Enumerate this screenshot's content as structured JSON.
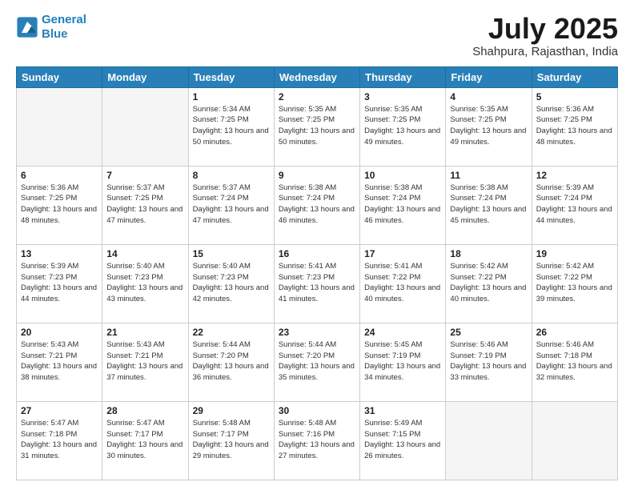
{
  "header": {
    "logo_line1": "General",
    "logo_line2": "Blue",
    "title": "July 2025",
    "subtitle": "Shahpura, Rajasthan, India"
  },
  "calendar": {
    "days_of_week": [
      "Sunday",
      "Monday",
      "Tuesday",
      "Wednesday",
      "Thursday",
      "Friday",
      "Saturday"
    ],
    "weeks": [
      [
        {
          "day": "",
          "info": ""
        },
        {
          "day": "",
          "info": ""
        },
        {
          "day": "1",
          "info": "Sunrise: 5:34 AM\nSunset: 7:25 PM\nDaylight: 13 hours and 50 minutes."
        },
        {
          "day": "2",
          "info": "Sunrise: 5:35 AM\nSunset: 7:25 PM\nDaylight: 13 hours and 50 minutes."
        },
        {
          "day": "3",
          "info": "Sunrise: 5:35 AM\nSunset: 7:25 PM\nDaylight: 13 hours and 49 minutes."
        },
        {
          "day": "4",
          "info": "Sunrise: 5:35 AM\nSunset: 7:25 PM\nDaylight: 13 hours and 49 minutes."
        },
        {
          "day": "5",
          "info": "Sunrise: 5:36 AM\nSunset: 7:25 PM\nDaylight: 13 hours and 48 minutes."
        }
      ],
      [
        {
          "day": "6",
          "info": "Sunrise: 5:36 AM\nSunset: 7:25 PM\nDaylight: 13 hours and 48 minutes."
        },
        {
          "day": "7",
          "info": "Sunrise: 5:37 AM\nSunset: 7:25 PM\nDaylight: 13 hours and 47 minutes."
        },
        {
          "day": "8",
          "info": "Sunrise: 5:37 AM\nSunset: 7:24 PM\nDaylight: 13 hours and 47 minutes."
        },
        {
          "day": "9",
          "info": "Sunrise: 5:38 AM\nSunset: 7:24 PM\nDaylight: 13 hours and 46 minutes."
        },
        {
          "day": "10",
          "info": "Sunrise: 5:38 AM\nSunset: 7:24 PM\nDaylight: 13 hours and 46 minutes."
        },
        {
          "day": "11",
          "info": "Sunrise: 5:38 AM\nSunset: 7:24 PM\nDaylight: 13 hours and 45 minutes."
        },
        {
          "day": "12",
          "info": "Sunrise: 5:39 AM\nSunset: 7:24 PM\nDaylight: 13 hours and 44 minutes."
        }
      ],
      [
        {
          "day": "13",
          "info": "Sunrise: 5:39 AM\nSunset: 7:23 PM\nDaylight: 13 hours and 44 minutes."
        },
        {
          "day": "14",
          "info": "Sunrise: 5:40 AM\nSunset: 7:23 PM\nDaylight: 13 hours and 43 minutes."
        },
        {
          "day": "15",
          "info": "Sunrise: 5:40 AM\nSunset: 7:23 PM\nDaylight: 13 hours and 42 minutes."
        },
        {
          "day": "16",
          "info": "Sunrise: 5:41 AM\nSunset: 7:23 PM\nDaylight: 13 hours and 41 minutes."
        },
        {
          "day": "17",
          "info": "Sunrise: 5:41 AM\nSunset: 7:22 PM\nDaylight: 13 hours and 40 minutes."
        },
        {
          "day": "18",
          "info": "Sunrise: 5:42 AM\nSunset: 7:22 PM\nDaylight: 13 hours and 40 minutes."
        },
        {
          "day": "19",
          "info": "Sunrise: 5:42 AM\nSunset: 7:22 PM\nDaylight: 13 hours and 39 minutes."
        }
      ],
      [
        {
          "day": "20",
          "info": "Sunrise: 5:43 AM\nSunset: 7:21 PM\nDaylight: 13 hours and 38 minutes."
        },
        {
          "day": "21",
          "info": "Sunrise: 5:43 AM\nSunset: 7:21 PM\nDaylight: 13 hours and 37 minutes."
        },
        {
          "day": "22",
          "info": "Sunrise: 5:44 AM\nSunset: 7:20 PM\nDaylight: 13 hours and 36 minutes."
        },
        {
          "day": "23",
          "info": "Sunrise: 5:44 AM\nSunset: 7:20 PM\nDaylight: 13 hours and 35 minutes."
        },
        {
          "day": "24",
          "info": "Sunrise: 5:45 AM\nSunset: 7:19 PM\nDaylight: 13 hours and 34 minutes."
        },
        {
          "day": "25",
          "info": "Sunrise: 5:46 AM\nSunset: 7:19 PM\nDaylight: 13 hours and 33 minutes."
        },
        {
          "day": "26",
          "info": "Sunrise: 5:46 AM\nSunset: 7:18 PM\nDaylight: 13 hours and 32 minutes."
        }
      ],
      [
        {
          "day": "27",
          "info": "Sunrise: 5:47 AM\nSunset: 7:18 PM\nDaylight: 13 hours and 31 minutes."
        },
        {
          "day": "28",
          "info": "Sunrise: 5:47 AM\nSunset: 7:17 PM\nDaylight: 13 hours and 30 minutes."
        },
        {
          "day": "29",
          "info": "Sunrise: 5:48 AM\nSunset: 7:17 PM\nDaylight: 13 hours and 29 minutes."
        },
        {
          "day": "30",
          "info": "Sunrise: 5:48 AM\nSunset: 7:16 PM\nDaylight: 13 hours and 27 minutes."
        },
        {
          "day": "31",
          "info": "Sunrise: 5:49 AM\nSunset: 7:15 PM\nDaylight: 13 hours and 26 minutes."
        },
        {
          "day": "",
          "info": ""
        },
        {
          "day": "",
          "info": ""
        }
      ]
    ]
  }
}
